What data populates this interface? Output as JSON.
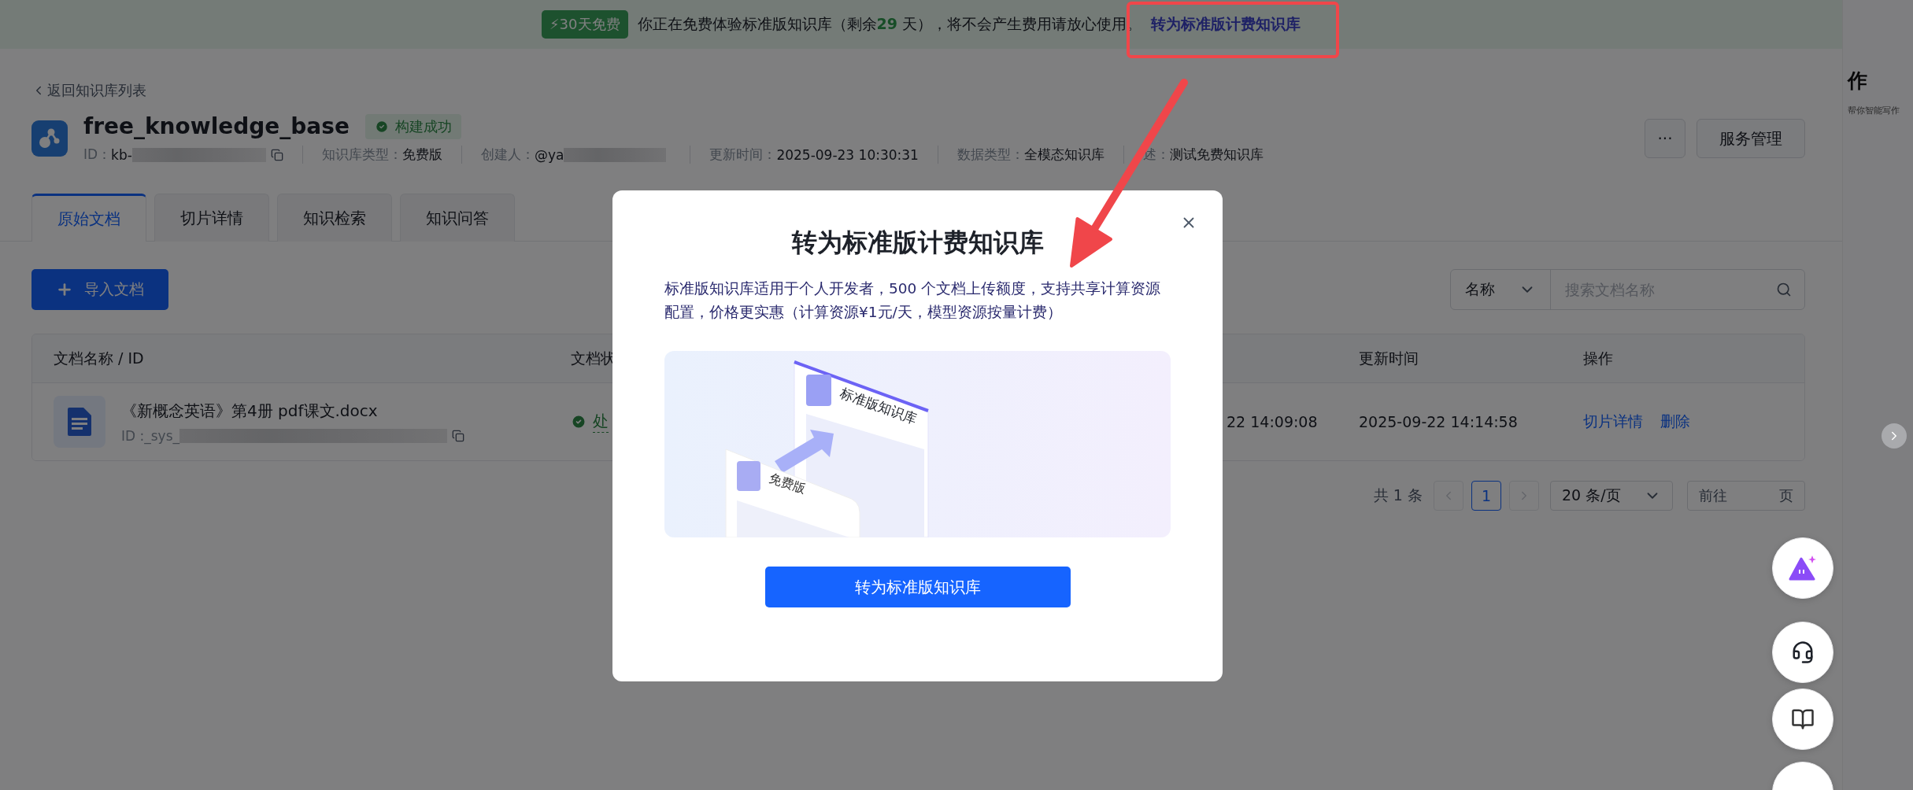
{
  "banner": {
    "badge": "⚡30天免费",
    "message": "你正在免费体验标准版知识库（剩余**29** 天），将不会产生费用请放心使用。",
    "link": "转为标准版计费知识库"
  },
  "assistant_panel": {
    "title": "作",
    "subtitle": "帮你智能写作"
  },
  "back_link": "返回知识库列表",
  "knowledge_base": {
    "name": "free_knowledge_base",
    "status": "构建成功",
    "meta": [
      {
        "label": "ID：",
        "value": "kb-",
        "kind": "id"
      },
      {
        "label": "知识库类型：",
        "value": "免费版",
        "kind": "plain"
      },
      {
        "label": "创建人：",
        "value": "@ya",
        "kind": "user"
      },
      {
        "label": "更新时间：",
        "value": "2025-09-23 10:30:31",
        "kind": "plain"
      },
      {
        "label": "数据类型：",
        "value": "全模态知识库",
        "kind": "plain"
      },
      {
        "label": "述：",
        "value": "测试免费知识库",
        "kind": "plain"
      }
    ]
  },
  "actions": {
    "more": "···",
    "manage": "服务管理"
  },
  "tabs": [
    {
      "label": "原始文档",
      "selected": true
    },
    {
      "label": "切片详情",
      "selected": false
    },
    {
      "label": "知识检索",
      "selected": false
    },
    {
      "label": "知识问答",
      "selected": false
    }
  ],
  "import_button": "导入文档",
  "search": {
    "filter": "名称",
    "placeholder": "搜索文档名称"
  },
  "table": {
    "columns": {
      "name": "文档名称 / ID",
      "status": "文档状",
      "updated": "更新时间",
      "actions": "操作"
    },
    "rows": [
      {
        "name": "《新概念英语》第4册 pdf课文.docx",
        "id": "ID :_sys_",
        "status": "处",
        "column_3": "22 14:09:08",
        "updated": "2025-09-22 14:14:58",
        "actions": [
          "切片详情",
          "删除"
        ]
      }
    ]
  },
  "pagination": {
    "total": "共 1 条",
    "pages": [
      {
        "label": "1",
        "selected": true
      }
    ],
    "page_size": "20 条/页",
    "goto_prefix": "前往",
    "goto_suffix": "页"
  },
  "modal": {
    "title": "转为标准版计费知识库",
    "description": "标准版知识库适用于个人开发者，500 个文档上传额度，支持共享计算资源配置，价格更实惠（计算资源¥1元/天，模型资源按量计费）",
    "illustration": {
      "back_label": "标准版知识库",
      "front_label": "免费版"
    },
    "button": "转为标准版知识库"
  }
}
